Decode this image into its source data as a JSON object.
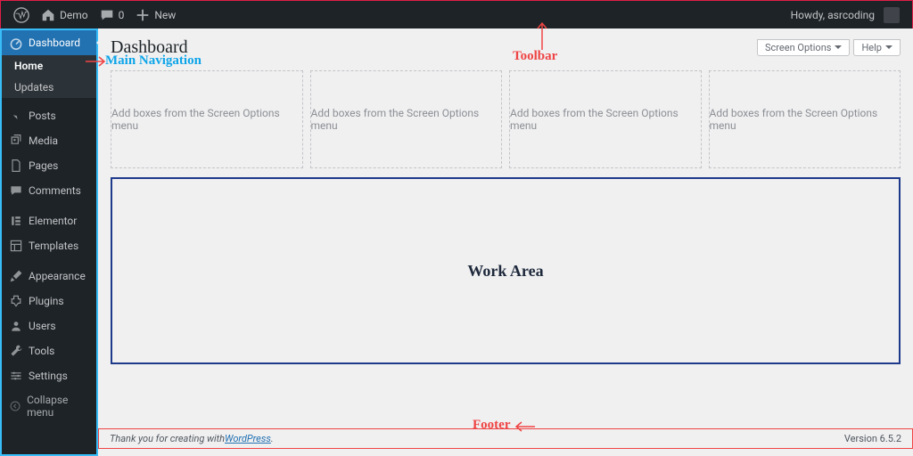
{
  "adminbar": {
    "site_name": "Demo",
    "comments_count": "0",
    "new_label": "New",
    "howdy": "Howdy, asrcoding"
  },
  "sidebar": {
    "dashboard": "Dashboard",
    "home": "Home",
    "updates": "Updates",
    "posts": "Posts",
    "media": "Media",
    "pages": "Pages",
    "comments": "Comments",
    "elementor": "Elementor",
    "templates": "Templates",
    "appearance": "Appearance",
    "plugins": "Plugins",
    "users": "Users",
    "tools": "Tools",
    "settings": "Settings",
    "collapse": "Collapse menu"
  },
  "page": {
    "title": "Dashboard",
    "screen_options": "Screen Options",
    "help": "Help",
    "empty_box_hint": "Add boxes from the Screen Options menu"
  },
  "annotations": {
    "toolbar": "Toolbar",
    "main_nav": "Main Navigation",
    "work_area": "Work Area",
    "footer": "Footer"
  },
  "footer": {
    "thankyou_prefix": "Thank you for creating with ",
    "wordpress_link": "WordPress",
    "thankyou_suffix": ".",
    "version": "Version 6.5.2"
  }
}
